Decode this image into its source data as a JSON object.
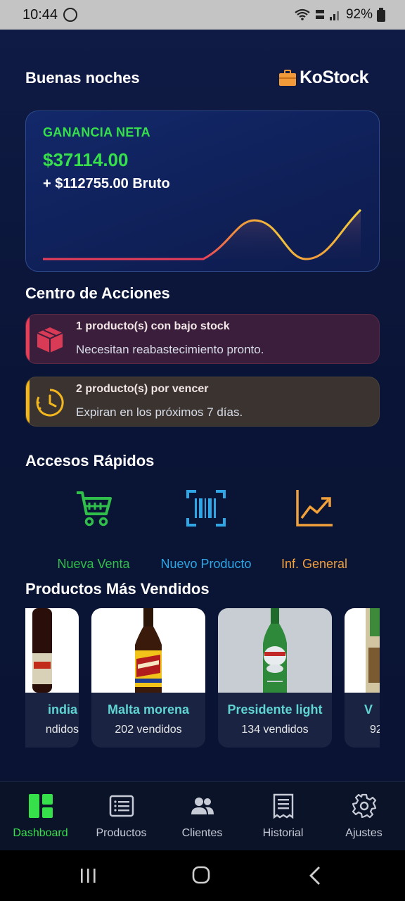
{
  "status_bar": {
    "time": "10:44",
    "battery": "92%",
    "icons": [
      "whatsapp-icon",
      "wifi-icon",
      "volte-icon",
      "signal-icon",
      "battery-icon"
    ]
  },
  "header": {
    "greeting": "Buenas noches",
    "brand": "KoStock"
  },
  "profit_card": {
    "label": "GANANCIA NETA",
    "net": "$37114.00",
    "gross": "+ $112755.00 Bruto"
  },
  "actions": {
    "title": "Centro de Acciones",
    "items": [
      {
        "title": "1 producto(s) con bajo stock",
        "desc": "Necesitan reabastecimiento pronto.",
        "icon": "box-icon",
        "color": "#e63d59"
      },
      {
        "title": "2 producto(s) por vencer",
        "desc": "Expiran en los próximos 7 días.",
        "icon": "clock-icon",
        "color": "#f2b61e"
      }
    ]
  },
  "quick": {
    "title": "Accesos Rápidos",
    "items": [
      {
        "label": "Nueva Venta",
        "icon": "cart-icon",
        "color": "#2fbf4a"
      },
      {
        "label": "Nuevo Producto",
        "icon": "barcode-scan-icon",
        "color": "#2fa7e6"
      },
      {
        "label": "Inf. General",
        "icon": "trend-chart-icon",
        "color": "#f2a03a"
      }
    ]
  },
  "products": {
    "title": "Productos Más Vendidos",
    "items": [
      {
        "name": "india",
        "sold": "ndidos"
      },
      {
        "name": "Malta morena",
        "sold": "202 vendidos"
      },
      {
        "name": "Presidente light",
        "sold": "134 vendidos"
      },
      {
        "name": "V",
        "sold": "92"
      }
    ]
  },
  "bottom_nav": {
    "items": [
      {
        "label": "Dashboard",
        "icon": "dashboard-icon",
        "active": true
      },
      {
        "label": "Productos",
        "icon": "list-icon",
        "active": false
      },
      {
        "label": "Clientes",
        "icon": "users-icon",
        "active": false
      },
      {
        "label": "Historial",
        "icon": "receipt-icon",
        "active": false
      },
      {
        "label": "Ajustes",
        "icon": "gear-icon",
        "active": false
      }
    ]
  },
  "colors": {
    "accent_green": "#35e04a",
    "danger": "#e63d59",
    "warning": "#f2b61e",
    "info": "#2fa7e6",
    "orange": "#f2a03a"
  }
}
